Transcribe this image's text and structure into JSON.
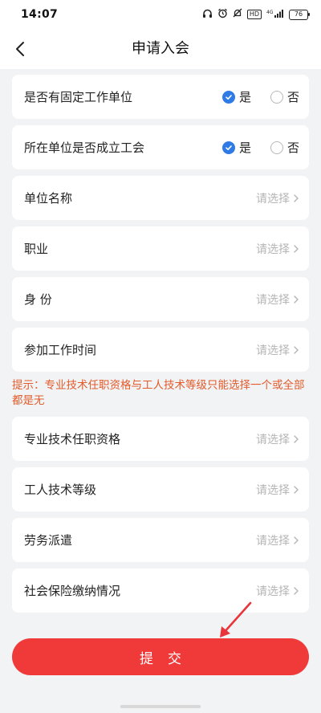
{
  "status": {
    "time": "14:07",
    "battery": "76",
    "network": "4G",
    "hd": "HD"
  },
  "header": {
    "title": "申请入会"
  },
  "radio_rows": [
    {
      "label": "是否有固定工作单位",
      "yes_label": "是",
      "no_label": "否",
      "selected": "是"
    },
    {
      "label": "所在单位是否成立工会",
      "yes_label": "是",
      "no_label": "否",
      "selected": "是"
    }
  ],
  "select_rows_top": [
    {
      "label": "单位名称",
      "placeholder": "请选择"
    },
    {
      "label": "职业",
      "placeholder": "请选择"
    },
    {
      "label": "身 份",
      "placeholder": "请选择"
    },
    {
      "label": "参加工作时间",
      "placeholder": "请选择"
    }
  ],
  "hint": "提示：专业技术任职资格与工人技术等级只能选择一个或全部都是无",
  "select_rows_bottom": [
    {
      "label": "专业技术任职资格",
      "placeholder": "请选择"
    },
    {
      "label": "工人技术等级",
      "placeholder": "请选择"
    },
    {
      "label": "劳务派遣",
      "placeholder": "请选择"
    },
    {
      "label": "社会保险缴纳情况",
      "placeholder": "请选择"
    }
  ],
  "submit": {
    "label": "提交"
  },
  "colors": {
    "accent_blue": "#2f7be6",
    "submit_red": "#f03a3a",
    "hint_orange": "#e35b2b",
    "background": "#f2f3f5"
  }
}
